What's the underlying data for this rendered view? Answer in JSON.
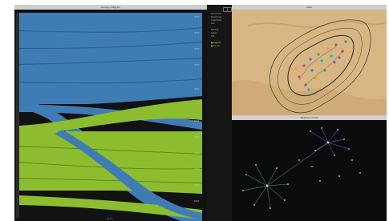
{
  "sankey": {
    "title": "Sankey Diagram",
    "footer": "[?] [?]"
  },
  "map": {
    "title": "Map"
  },
  "network": {
    "title": "Network Chart"
  },
  "controls": {
    "lines": [
      "Color Hull",
      "Recoloring",
      "Customize",
      "hub",
      "",
      "STATUS",
      "Label",
      "Off",
      "",
      "● Legend",
      "■ Shade"
    ]
  },
  "colors": {
    "blue": "#3f7cb6",
    "green": "#8cbd2e",
    "map_bg": "#d8b684"
  }
}
